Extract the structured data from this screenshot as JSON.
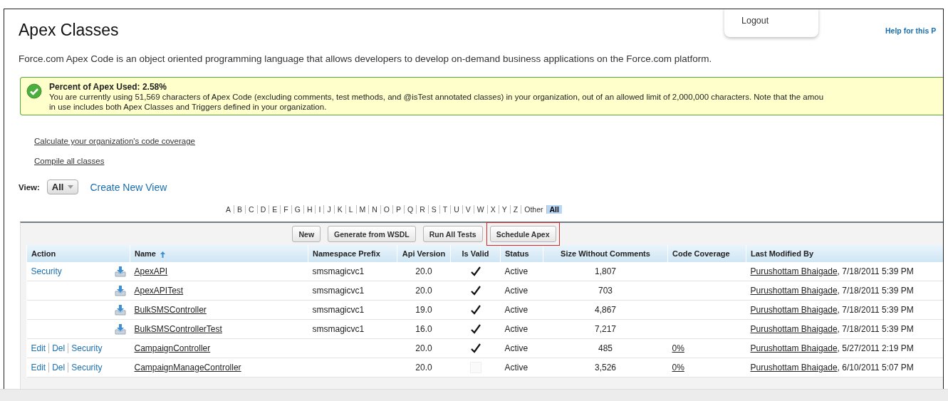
{
  "header": {
    "title": "Apex Classes",
    "help_link": "Help for this P"
  },
  "user_menu": {
    "items": [
      "Logout"
    ]
  },
  "description": "Force.com Apex Code is an object oriented programming language that allows developers to develop on-demand business applications on the Force.com platform.",
  "message": {
    "kind": "success",
    "title": "Percent of Apex Used: 2.58%",
    "lines": [
      "You are currently using 51,569 characters of Apex Code (excluding comments, test methods, and @isTest annotated classes) in your organization, out of an allowed limit of 2,000,000 characters. Note that the amou",
      "in use includes both Apex Classes and Triggers defined in your organization."
    ]
  },
  "links": [
    "Calculate your organization's code coverage",
    "Compile all classes"
  ],
  "view": {
    "label": "View:",
    "value": "All",
    "create_link": "Create New View"
  },
  "alphabet": [
    {
      "label": "A",
      "selected": false
    },
    {
      "label": "B",
      "selected": false
    },
    {
      "label": "C",
      "selected": false
    },
    {
      "label": "D",
      "selected": false
    },
    {
      "label": "E",
      "selected": false
    },
    {
      "label": "F",
      "selected": false
    },
    {
      "label": "G",
      "selected": false
    },
    {
      "label": "H",
      "selected": false
    },
    {
      "label": "I",
      "selected": false
    },
    {
      "label": "J",
      "selected": false
    },
    {
      "label": "K",
      "selected": false
    },
    {
      "label": "L",
      "selected": false
    },
    {
      "label": "M",
      "selected": false
    },
    {
      "label": "N",
      "selected": false
    },
    {
      "label": "O",
      "selected": false
    },
    {
      "label": "P",
      "selected": false
    },
    {
      "label": "Q",
      "selected": false
    },
    {
      "label": "R",
      "selected": false
    },
    {
      "label": "S",
      "selected": false
    },
    {
      "label": "T",
      "selected": false
    },
    {
      "label": "U",
      "selected": false
    },
    {
      "label": "V",
      "selected": false
    },
    {
      "label": "W",
      "selected": false
    },
    {
      "label": "X",
      "selected": false
    },
    {
      "label": "Y",
      "selected": false
    },
    {
      "label": "Z",
      "selected": false
    },
    {
      "label": "Other",
      "selected": false
    },
    {
      "label": "All",
      "selected": true
    }
  ],
  "toolbar": [
    {
      "label": "New",
      "highlighted": false
    },
    {
      "label": "Generate from WSDL",
      "highlighted": false
    },
    {
      "label": "Run All Tests",
      "highlighted": false
    },
    {
      "label": "Schedule Apex",
      "highlighted": true
    }
  ],
  "table": {
    "columns": [
      {
        "label": "Action",
        "sorted": false
      },
      {
        "label": "Name",
        "sorted": true
      },
      {
        "label": "Namespace Prefix",
        "sorted": false
      },
      {
        "label": "Api Version",
        "sorted": false
      },
      {
        "label": "Is Valid",
        "sorted": false
      },
      {
        "label": "Status",
        "sorted": false
      },
      {
        "label": "Size Without Comments",
        "sorted": false
      },
      {
        "label": "Code Coverage",
        "sorted": false
      },
      {
        "label": "Last Modified By",
        "sorted": false
      }
    ],
    "rows": [
      {
        "actions": [
          "Security"
        ],
        "download": true,
        "name": "ApexAPI",
        "namespace": "smsmagicvc1",
        "api_version": "20.0",
        "is_valid": true,
        "status": "Active",
        "size": "1,807",
        "modified_by": "Purushottam Bhaigade",
        "modified_at": ", 7/18/2011 5:39 PM"
      },
      {
        "download": true,
        "name": "ApexAPITest",
        "namespace": "smsmagicvc1",
        "api_version": "20.0",
        "is_valid": true,
        "status": "Active",
        "size": "703",
        "modified_by": "Purushottam Bhaigade",
        "modified_at": ", 7/18/2011 5:39 PM"
      },
      {
        "download": true,
        "name": "BulkSMSController",
        "namespace": "smsmagicvc1",
        "api_version": "19.0",
        "is_valid": true,
        "status": "Active",
        "size": "4,867",
        "modified_by": "Purushottam Bhaigade",
        "modified_at": ", 7/18/2011 5:39 PM"
      },
      {
        "download": true,
        "name": "BulkSMSControllerTest",
        "namespace": "smsmagicvc1",
        "api_version": "16.0",
        "is_valid": true,
        "status": "Active",
        "size": "7,217",
        "modified_by": "Purushottam Bhaigade",
        "modified_at": ", 7/18/2011 5:39 PM"
      },
      {
        "actions": [
          "Edit",
          "Del",
          "Security"
        ],
        "download": false,
        "name": "CampaignController",
        "api_version": "20.0",
        "is_valid": true,
        "status": "Active",
        "size": "485",
        "coverage": "0%",
        "modified_by": "Purushottam Bhaigade",
        "modified_at": ", 5/27/2011 2:19 PM"
      },
      {
        "actions": [
          "Edit",
          "Del",
          "Security"
        ],
        "download": false,
        "name": "CampaignManageController",
        "api_version": "20.0",
        "is_valid": false,
        "status": "Active",
        "size": "3,526",
        "coverage": "0%",
        "modified_by": "Purushottam Bhaigade",
        "modified_at": ", 6/10/2011 5:07 PM"
      }
    ]
  }
}
